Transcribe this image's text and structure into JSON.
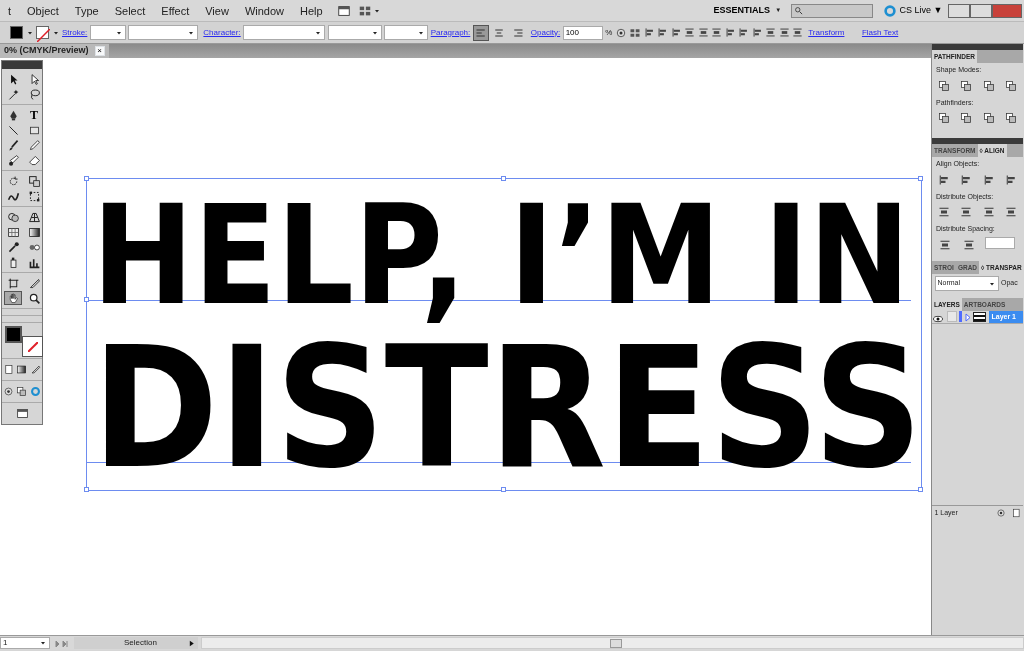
{
  "menu": {
    "items": [
      "t",
      "Object",
      "Type",
      "Select",
      "Effect",
      "View",
      "Window",
      "Help"
    ]
  },
  "app_bar": {
    "workspace": "ESSENTIALS",
    "workspace_caret": "▼",
    "cs_live": "CS Live",
    "cs_live_caret": "▼"
  },
  "control_bar": {
    "fill_none": false,
    "stroke_none": true,
    "stroke_link": "Stroke:",
    "character_link": "Character:",
    "paragraph_link": "Paragraph:",
    "paragraph_align": [
      {
        "kind": "left",
        "selected": true
      },
      {
        "kind": "center",
        "selected": false
      },
      {
        "kind": "right",
        "selected": false
      }
    ],
    "opacity_link": "Opacity:",
    "opacity": "100",
    "percent": "%",
    "transform_link": "Transform",
    "flash_text_link": "Flash Text"
  },
  "document_tab": {
    "title": "0% (CMYK/Preview)",
    "close": "×"
  },
  "tools": [
    {
      "kind": "arrow",
      "selected": false
    },
    {
      "kind": "hollow-arrow",
      "selected": false
    },
    {
      "kind": "wand",
      "selected": false
    },
    {
      "kind": "lasso",
      "selected": false
    },
    {
      "kind": "pen",
      "selected": false
    },
    {
      "kind": "type",
      "glyph": "T",
      "selected": false
    },
    {
      "kind": "line",
      "selected": false
    },
    {
      "kind": "rect",
      "selected": false
    },
    {
      "kind": "brush",
      "selected": false
    },
    {
      "kind": "pencil",
      "selected": false
    },
    {
      "kind": "blob",
      "selected": false
    },
    {
      "kind": "eraser",
      "selected": false
    },
    {
      "kind": "rotate",
      "selected": false
    },
    {
      "kind": "scale",
      "selected": false
    },
    {
      "kind": "warp",
      "selected": false
    },
    {
      "kind": "free-transform",
      "selected": false
    },
    {
      "kind": "shape-builder",
      "selected": false
    },
    {
      "kind": "perspective",
      "selected": false
    },
    {
      "kind": "mesh",
      "selected": false
    },
    {
      "kind": "gradient",
      "selected": false
    },
    {
      "kind": "eyedropper",
      "selected": false
    },
    {
      "kind": "blend",
      "selected": false
    },
    {
      "kind": "spray",
      "selected": false
    },
    {
      "kind": "graph",
      "selected": false
    },
    {
      "kind": "artboard",
      "selected": false
    },
    {
      "kind": "slice",
      "selected": false
    },
    {
      "kind": "hand",
      "selected": true
    },
    {
      "kind": "zoom",
      "selected": false
    }
  ],
  "toolbox_swatches": {
    "fill_none": false,
    "stroke_none": true
  },
  "artwork": {
    "lines": [
      "HELP, I’M IN",
      "DISTRESS"
    ]
  },
  "pathfinder": {
    "tab": "PATHFINDER",
    "shape_modes": "Shape Modes:",
    "pathfinders": "Pathfinders:"
  },
  "align": {
    "tabs": [
      {
        "label": "TRANSFORM",
        "selected": false
      },
      {
        "label": "◊ ALIGN",
        "selected": true
      }
    ],
    "align_objects": "Align Objects:",
    "distribute_objects": "Distribute Objects:",
    "distribute_spacing": "Distribute Spacing:"
  },
  "transparency": {
    "tabs": [
      {
        "label": "STROI",
        "selected": false
      },
      {
        "label": "GRAD",
        "selected": false
      },
      {
        "label": "◊ TRANSPAR",
        "selected": true
      }
    ],
    "blend_mode": "Normal",
    "opacity_label": "Opac"
  },
  "layers": {
    "tabs": [
      {
        "label": "LAYERS",
        "selected": true
      },
      {
        "label": "ARTBOARDS",
        "selected": false
      }
    ],
    "items": [
      {
        "name": "Layer 1",
        "visible": true,
        "selected": true,
        "color": "#4f6bff"
      }
    ],
    "footer": "1 Layer"
  },
  "status_bar": {
    "zoom": "1",
    "tool": "Selection"
  }
}
